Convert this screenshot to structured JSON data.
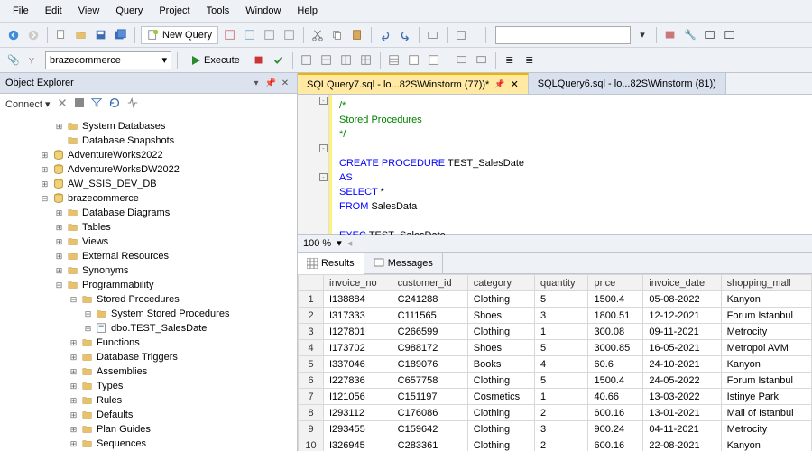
{
  "menu": [
    "File",
    "Edit",
    "View",
    "Query",
    "Project",
    "Tools",
    "Window",
    "Help"
  ],
  "toolbar": {
    "newquery": "New Query",
    "db": "brazecommerce",
    "execute": "Execute"
  },
  "explorer": {
    "title": "Object Explorer",
    "connect": "Connect",
    "tree": [
      {
        "depth": 2,
        "exp": "+",
        "icon": "folder",
        "label": "System Databases"
      },
      {
        "depth": 2,
        "exp": "",
        "icon": "folder",
        "label": "Database Snapshots"
      },
      {
        "depth": 1,
        "exp": "+",
        "icon": "db",
        "label": "AdventureWorks2022"
      },
      {
        "depth": 1,
        "exp": "+",
        "icon": "db",
        "label": "AdventureWorksDW2022"
      },
      {
        "depth": 1,
        "exp": "+",
        "icon": "db",
        "label": "AW_SSIS_DEV_DB"
      },
      {
        "depth": 1,
        "exp": "-",
        "icon": "db",
        "label": "brazecommerce"
      },
      {
        "depth": 2,
        "exp": "+",
        "icon": "folder",
        "label": "Database Diagrams"
      },
      {
        "depth": 2,
        "exp": "+",
        "icon": "folder",
        "label": "Tables"
      },
      {
        "depth": 2,
        "exp": "+",
        "icon": "folder",
        "label": "Views"
      },
      {
        "depth": 2,
        "exp": "+",
        "icon": "folder",
        "label": "External Resources"
      },
      {
        "depth": 2,
        "exp": "+",
        "icon": "folder",
        "label": "Synonyms"
      },
      {
        "depth": 2,
        "exp": "-",
        "icon": "folder",
        "label": "Programmability"
      },
      {
        "depth": 3,
        "exp": "-",
        "icon": "folder",
        "label": "Stored Procedures"
      },
      {
        "depth": 4,
        "exp": "+",
        "icon": "folder",
        "label": "System Stored Procedures"
      },
      {
        "depth": 4,
        "exp": "+",
        "icon": "sp",
        "label": "dbo.TEST_SalesDate"
      },
      {
        "depth": 3,
        "exp": "+",
        "icon": "folder",
        "label": "Functions"
      },
      {
        "depth": 3,
        "exp": "+",
        "icon": "folder",
        "label": "Database Triggers"
      },
      {
        "depth": 3,
        "exp": "+",
        "icon": "folder",
        "label": "Assemblies"
      },
      {
        "depth": 3,
        "exp": "+",
        "icon": "folder",
        "label": "Types"
      },
      {
        "depth": 3,
        "exp": "+",
        "icon": "folder",
        "label": "Rules"
      },
      {
        "depth": 3,
        "exp": "+",
        "icon": "folder",
        "label": "Defaults"
      },
      {
        "depth": 3,
        "exp": "+",
        "icon": "folder",
        "label": "Plan Guides"
      },
      {
        "depth": 3,
        "exp": "+",
        "icon": "folder",
        "label": "Sequences"
      }
    ]
  },
  "tabs": [
    {
      "label": "SQLQuery7.sql - lo...82S\\Winstorm (77))*",
      "active": true
    },
    {
      "label": "SQLQuery6.sql - lo...82S\\Winstorm (81))",
      "active": false
    }
  ],
  "sql": {
    "l1": "/*",
    "l2": "Stored Procedures",
    "l3": "*/",
    "l4a": "CREATE ",
    "l4b": "PROCEDURE ",
    "l4c": "TEST_SalesDate",
    "l5": "AS",
    "l6a": "SELECT ",
    "l6b": "*",
    "l7a": "FROM ",
    "l7b": "SalesData",
    "l8a": "EXEC ",
    "l8b": "TEST_SalesDate"
  },
  "zoom": "100 %",
  "restabs": {
    "results": "Results",
    "messages": "Messages"
  },
  "grid": {
    "cols": [
      "invoice_no",
      "customer_id",
      "category",
      "quantity",
      "price",
      "invoice_date",
      "shopping_mall"
    ],
    "rows": [
      [
        "I138884",
        "C241288",
        "Clothing",
        "5",
        "1500.4",
        "05-08-2022",
        "Kanyon"
      ],
      [
        "I317333",
        "C111565",
        "Shoes",
        "3",
        "1800.51",
        "12-12-2021",
        "Forum Istanbul"
      ],
      [
        "I127801",
        "C266599",
        "Clothing",
        "1",
        "300.08",
        "09-11-2021",
        "Metrocity"
      ],
      [
        "I173702",
        "C988172",
        "Shoes",
        "5",
        "3000.85",
        "16-05-2021",
        "Metropol AVM"
      ],
      [
        "I337046",
        "C189076",
        "Books",
        "4",
        "60.6",
        "24-10-2021",
        "Kanyon"
      ],
      [
        "I227836",
        "C657758",
        "Clothing",
        "5",
        "1500.4",
        "24-05-2022",
        "Forum Istanbul"
      ],
      [
        "I121056",
        "C151197",
        "Cosmetics",
        "1",
        "40.66",
        "13-03-2022",
        "Istinye Park"
      ],
      [
        "I293112",
        "C176086",
        "Clothing",
        "2",
        "600.16",
        "13-01-2021",
        "Mall of Istanbul"
      ],
      [
        "I293455",
        "C159642",
        "Clothing",
        "3",
        "900.24",
        "04-11-2021",
        "Metrocity"
      ],
      [
        "I326945",
        "C283361",
        "Clothing",
        "2",
        "600.16",
        "22-08-2021",
        "Kanyon"
      ]
    ]
  }
}
